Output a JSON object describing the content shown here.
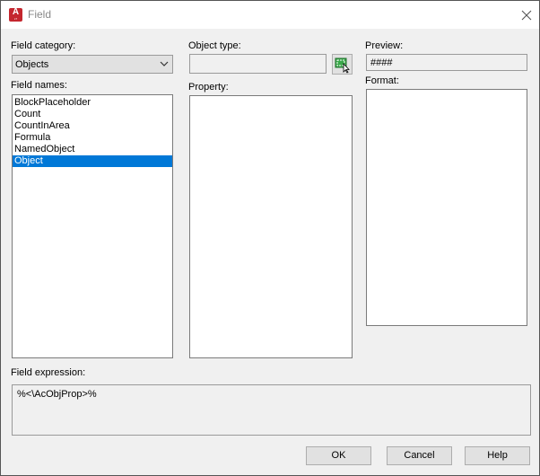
{
  "window": {
    "title": "Field",
    "app_icon": "autocad-lt-icon",
    "close_icon": "close-icon"
  },
  "field_category": {
    "label": "Field category:",
    "value": "Objects"
  },
  "field_names": {
    "label": "Field names:",
    "items": [
      "BlockPlaceholder",
      "Count",
      "CountInArea",
      "Formula",
      "NamedObject",
      "Object"
    ],
    "selected": "Object"
  },
  "object_type": {
    "label": "Object type:",
    "value": "",
    "select_button_icon": "select-objects-icon"
  },
  "property": {
    "label": "Property:"
  },
  "preview": {
    "label": "Preview:",
    "value": "####"
  },
  "format": {
    "label": "Format:"
  },
  "field_expression": {
    "label": "Field expression:",
    "value": "%<\\AcObjProp>%"
  },
  "buttons": {
    "ok": "OK",
    "cancel": "Cancel",
    "help": "Help"
  },
  "colors": {
    "selection": "#0078d7",
    "app_icon": "#c4262e"
  }
}
